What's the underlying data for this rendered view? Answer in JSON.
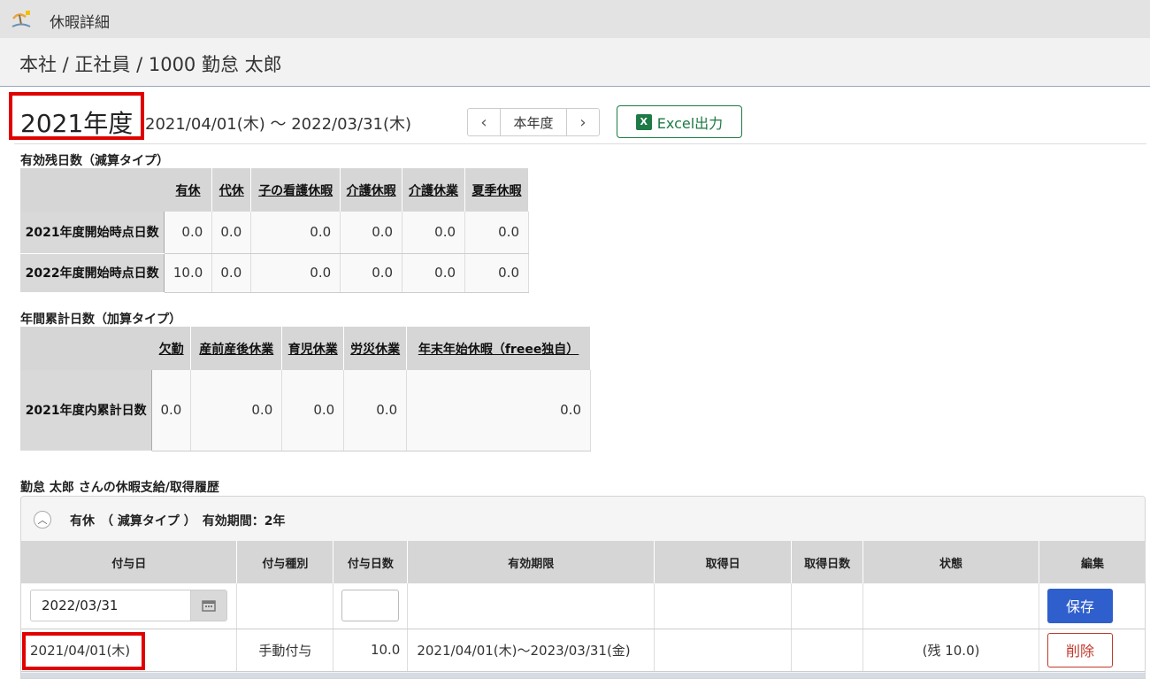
{
  "window": {
    "title": "休暇詳細",
    "icon": "beach-umbrella-icon"
  },
  "breadcrumb": "本社 / 正社員 / 1000 勤怠 太郎",
  "fiscal": {
    "title": "2021年度",
    "period": "2021/04/01(木) ～ 2022/03/31(木)",
    "nav_prev": "‹",
    "nav_current": "本年度",
    "nav_next": "›"
  },
  "excel_button": {
    "label": "Excel出力",
    "icon": "excel-icon"
  },
  "remaining": {
    "title": "有効残日数（減算タイプ）",
    "columns": [
      "有休",
      "代休",
      "子の看護休暇",
      "介護休暇",
      "介護休業",
      "夏季休暇"
    ],
    "rows": [
      {
        "label": "2021年度開始時点日数",
        "values": [
          "0.0",
          "0.0",
          "0.0",
          "0.0",
          "0.0",
          "0.0"
        ]
      },
      {
        "label": "2022年度開始時点日数",
        "values": [
          "10.0",
          "0.0",
          "0.0",
          "0.0",
          "0.0",
          "0.0"
        ]
      }
    ]
  },
  "cumulative": {
    "title": "年間累計日数（加算タイプ）",
    "columns": [
      "欠勤",
      "産前産後休業",
      "育児休業",
      "労災休業",
      "年末年始休暇（freee独自）"
    ],
    "rows": [
      {
        "label": "2021年度内累計日数",
        "values": [
          "0.0",
          "0.0",
          "0.0",
          "0.0",
          "0.0"
        ]
      }
    ]
  },
  "history": {
    "title": "勤怠 太郎 さんの休暇支給/取得履歴",
    "panel_title": "有休　（ 減算タイプ ）　有効期間：2年",
    "columns": [
      "付与日",
      "付与種別",
      "付与日数",
      "有効期限",
      "取得日",
      "取得日数",
      "状態",
      "編集"
    ],
    "new_row": {
      "date_value": "2022/03/31",
      "save_label": "保存"
    },
    "rows": [
      {
        "grant_date": "2021/04/01(木)",
        "grant_type": "手動付与",
        "grant_days": "10.0",
        "expiry": "2021/04/01(木)～2023/03/31(金)",
        "taken_date": "",
        "taken_days": "",
        "status": "(残 10.0)",
        "delete_label": "削除"
      }
    ]
  },
  "colors": {
    "highlight": "#e00000",
    "excel_green": "#1e7a45",
    "save_blue": "#2f5fcc",
    "delete_red": "#c0392b"
  }
}
